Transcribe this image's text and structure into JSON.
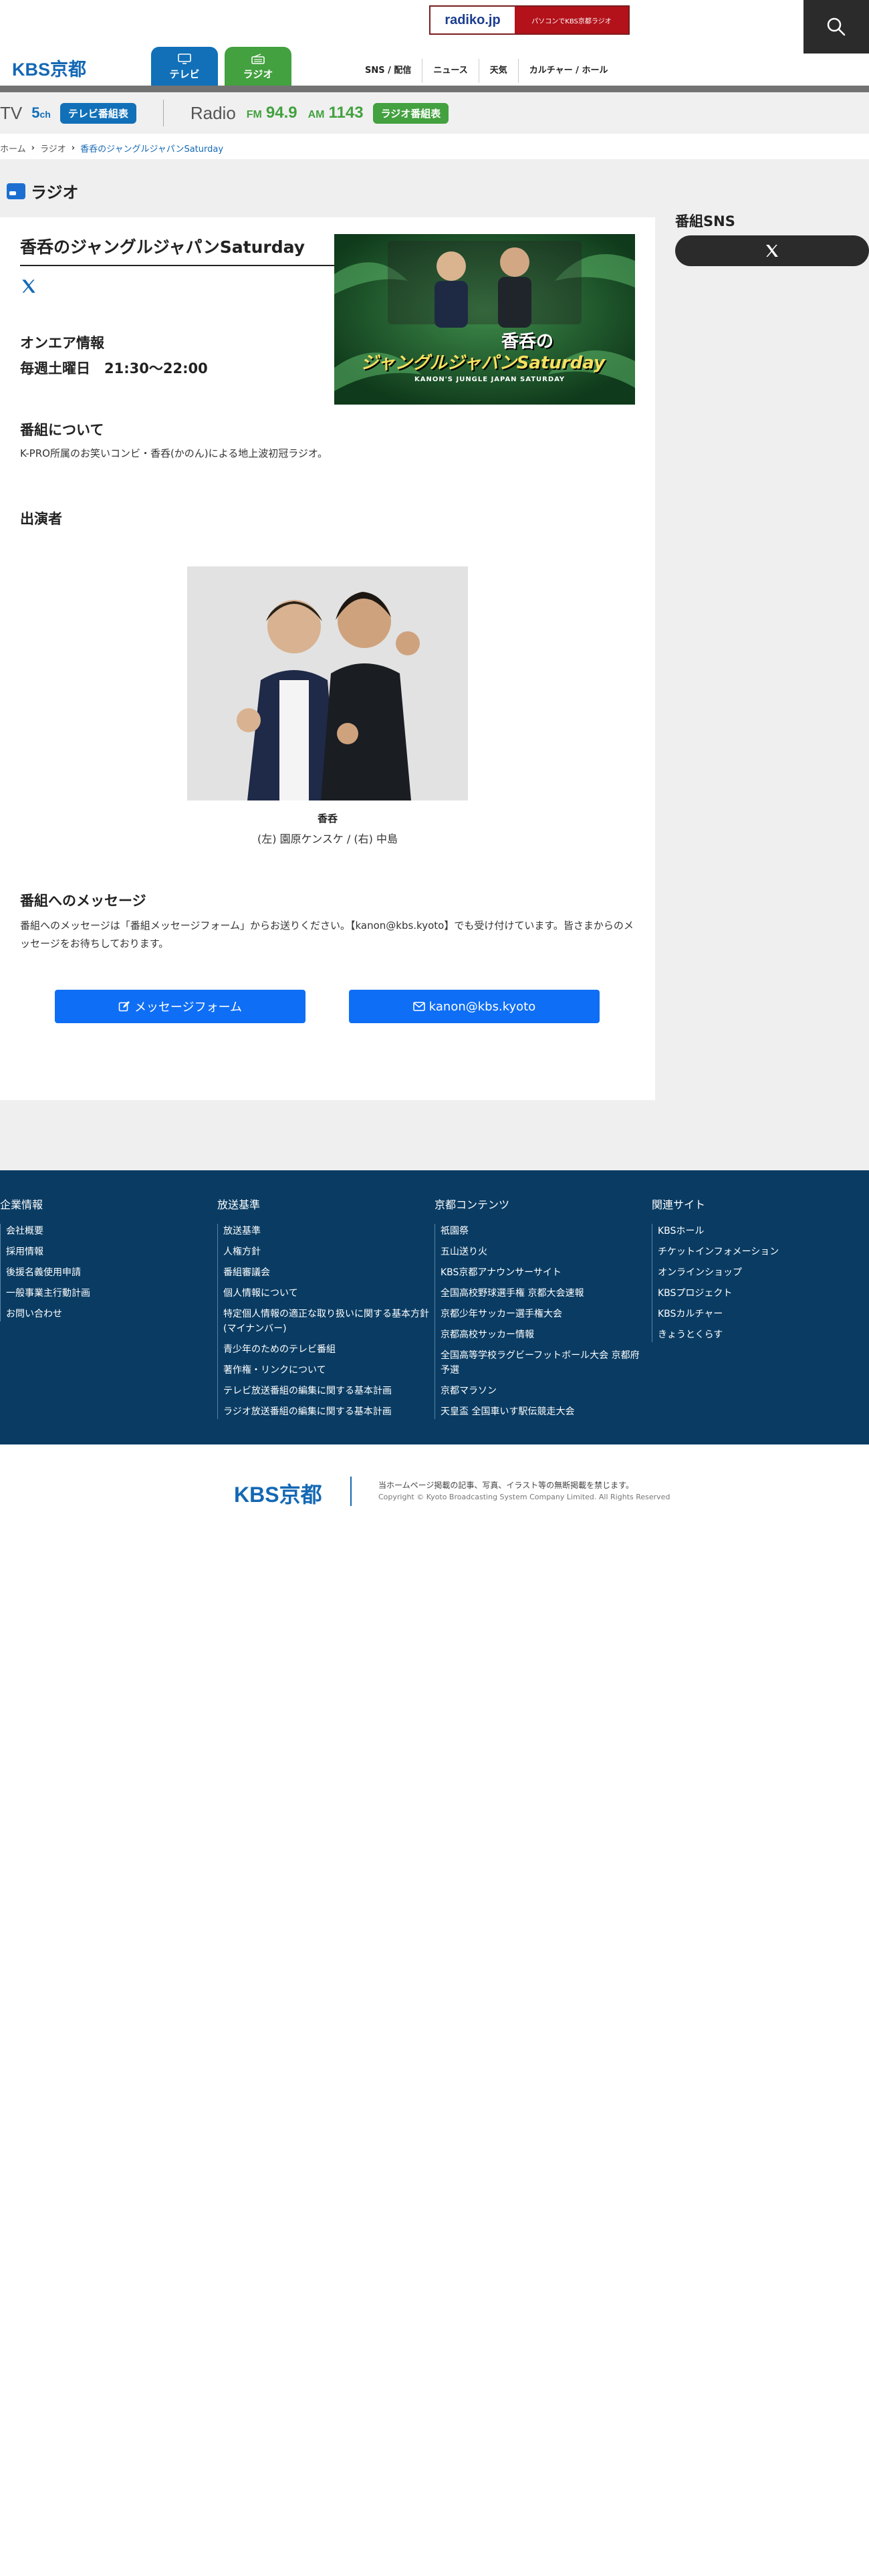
{
  "header": {
    "logo": "KBS京都",
    "radiko_logo": "radiko.jp",
    "radiko_text": "パソコンでKBS京都ラジオ",
    "tabs": [
      {
        "label": "テレビ"
      },
      {
        "label": "ラジオ"
      }
    ],
    "links": [
      "SNS / 配信",
      "ニュース",
      "天気",
      "カルチャー / ホール"
    ]
  },
  "strip": {
    "tv_label": "TV",
    "tv_channel": "5",
    "tv_channel_unit": "ch",
    "tv_button": "テレビ番組表",
    "radio_label": "Radio",
    "fm_band": "FM",
    "fm_freq": "94.9",
    "am_band": "AM",
    "am_freq": "1143",
    "radio_button": "ラジオ番組表"
  },
  "breadcrumb": [
    "ホーム",
    "ラジオ",
    "香呑のジャングルジャパンSaturday"
  ],
  "section": "ラジオ",
  "program": {
    "title": "香呑のジャングルジャパンSaturday",
    "hero_title_small": "香呑の",
    "hero_title": "ジャングルジャパンSaturday",
    "hero_subtitle": "KANON'S JUNGLE JAPAN SATURDAY",
    "onair_heading": "オンエア情報",
    "onair_time": "毎週土曜日　21:30〜22:00",
    "about_heading": "番組について",
    "about_text": "K-PRO所属のお笑いコンビ・香呑(かのん)による地上波初冠ラジオ。",
    "cast_heading": "出演者",
    "cast_name": "香呑",
    "cast_sub": "(左) 園原ケンスケ / (右) 中島",
    "message_heading": "番組へのメッセージ",
    "message_text": "番組へのメッセージは「番組メッセージフォーム」からお送りください。【kanon@kbs.kyoto】でも受け付けています。皆さまからのメッセージをお待ちしております。",
    "form_button": "メッセージフォーム",
    "mail_button": "kanon@kbs.kyoto"
  },
  "sidebar": {
    "heading": "番組SNS"
  },
  "footer": {
    "columns": [
      {
        "title": "企業情報",
        "items": [
          "会社概要",
          "採用情報",
          "後援名義使用申請",
          "一般事業主行動計画",
          "お問い合わせ"
        ]
      },
      {
        "title": "放送基準",
        "items": [
          "放送基準",
          "人権方針",
          "番組審議会",
          "個人情報について",
          "特定個人情報の適正な取り扱いに関する基本方針(マイナンバー)",
          "青少年のためのテレビ番組",
          "著作権・リンクについて",
          "テレビ放送番組の編集に関する基本計画",
          "ラジオ放送番組の編集に関する基本計画"
        ]
      },
      {
        "title": "京都コンテンツ",
        "items": [
          "祇園祭",
          "五山送り火",
          "KBS京都アナウンサーサイト",
          "全国高校野球選手権 京都大会速報",
          "京都少年サッカー選手権大会",
          "京都高校サッカー情報",
          "全国高等学校ラグビーフットボール大会 京都府予選",
          "京都マラソン",
          "天皇盃 全国車いす駅伝競走大会"
        ]
      },
      {
        "title": "関連サイト",
        "items": [
          "KBSホール",
          "チケットインフォメーション",
          "オンラインショップ",
          "KBSプロジェクト",
          "KBSカルチャー",
          "きょうとくらす"
        ]
      }
    ],
    "logo": "KBS京都",
    "note": "当ホームページ掲載の記事、写真、イラスト等の無断掲載を禁じます。",
    "copyright": "Copyright © Kyoto Broadcasting System Company Limited. All Rights Reserved"
  }
}
